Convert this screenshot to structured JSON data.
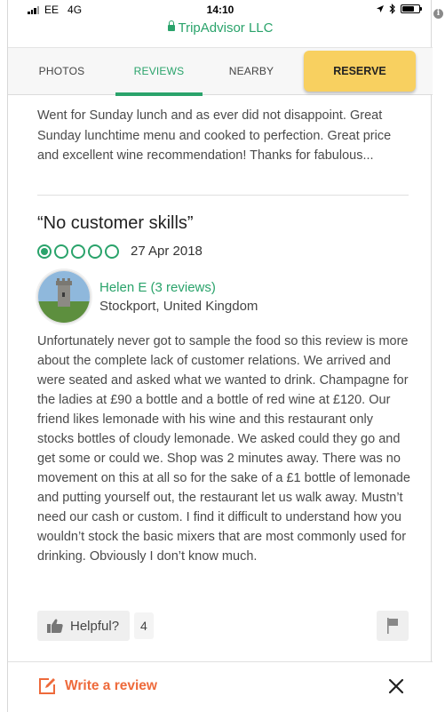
{
  "status_bar": {
    "carrier": "EE",
    "network": "4G",
    "time": "14:10"
  },
  "url_bar": {
    "site": "TripAdvisor LLC"
  },
  "tabs": [
    {
      "label": "PHOTOS",
      "active": false
    },
    {
      "label": "REVIEWS",
      "active": true
    },
    {
      "label": "NEARBY",
      "active": false
    }
  ],
  "reserve_button": {
    "label": "RESERVE",
    "color": "#f8d060"
  },
  "previous_review": {
    "snippet": "Went for Sunday lunch and as ever did not disappoint. Great Sunday lunchtime menu and cooked to perfection. Great price and excellent wine recommendation! Thanks for fabulous..."
  },
  "review": {
    "title": "“No customer skills”",
    "rating": 1,
    "rating_max": 5,
    "date": "27 Apr 2018",
    "user": {
      "name": "Helen E (3 reviews)",
      "location": "Stockport, United Kingdom"
    },
    "body": "Unfortunately never got to sample the food so this review is more about the complete lack of customer relations. We arrived and were seated and asked what we wanted to drink. Champagne for the ladies at £90 a bottle and a bottle of red wine at £120. Our friend likes lemonade with his wine and this restaurant only stocks bottles of cloudy lemonade. We asked could they go and get some or could we. Shop was 2 minutes away. There was no movement on this at all so for the sake of a £1 bottle of lemonade and putting yourself out, the restaurant let us walk away. Mustn’t need our cash or custom. I find it difficult to understand how you wouldn’t stock the basic mixers that are most commonly used for drinking. Obviously I don’t know much.",
    "helpful_label": "Helpful?",
    "helpful_count": "4"
  },
  "bottom_bar": {
    "write_review_label": "Write a review"
  },
  "colors": {
    "accent_green": "#2aa36b",
    "write_orange": "#ee6a3b"
  },
  "icons": [
    "lock-icon",
    "thumbs-up-icon",
    "flag-icon",
    "edit-icon",
    "close-icon",
    "bluetooth-icon",
    "location-arrow-icon",
    "battery-icon",
    "signal-icon",
    "info-icon"
  ]
}
